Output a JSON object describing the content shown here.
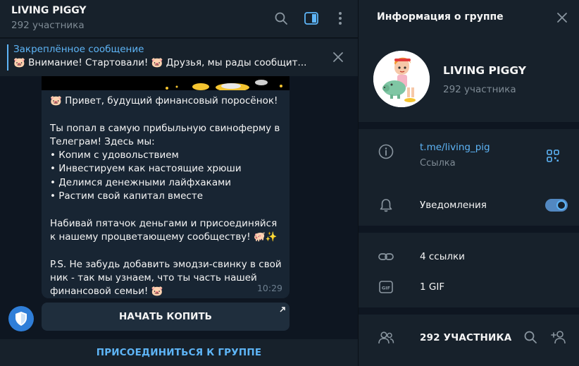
{
  "chat": {
    "title": "LIVING PIGGY",
    "subtitle": "292 участника",
    "pinned": {
      "title": "Закреплённое сообщение",
      "text": "🐷 Внимание! Стартовали! 🐷  Друзья, мы рады сообщит..."
    },
    "message": {
      "text": "🐷 Привет, будущий финансовый поросёнок!\n\nТы попал в самую прибыльную свиноферму в Телеграм! Здесь мы:\n• Копим с удовольствием\n• Инвестируем как настоящие хрюши\n• Делимся денежными лайфхаками\n• Растим свой капитал вместе\n\nНабивай пятачок деньгами и присоединяйся к нашему процветающему сообществу! 🐖✨\n\nP.S. Не забудь добавить эмодзи-свинку в свой ник - так мы узнаем, что ты часть нашей финансовой семьи! 🐷",
      "time": "10:29"
    },
    "inline_button": "НАЧАТЬ КОПИТЬ",
    "join_button": "ПРИСОЕДИНИТЬСЯ К ГРУППЕ"
  },
  "info": {
    "header_title": "Информация о группе",
    "group_name": "LIVING PIGGY",
    "group_members": "292 участника",
    "link": {
      "value": "t.me/living_pig",
      "label": "Ссылка"
    },
    "notifications": {
      "label": "Уведомления",
      "enabled": true
    },
    "media": {
      "links": "4 ссылки",
      "gifs": "1 GIF"
    },
    "members_title": "292 УЧАСТНИКА"
  },
  "colors": {
    "accent": "#5eb5f7",
    "panel": "#17212b",
    "background": "#0e1621",
    "bubble": "#182533"
  },
  "icons": [
    "search-icon",
    "sidebar-toggle-icon",
    "more-vertical-icon",
    "close-icon",
    "info-icon",
    "qr-code-icon",
    "bell-icon",
    "link-icon",
    "gif-icon",
    "members-icon",
    "add-member-icon",
    "external-arrow-icon",
    "shield-icon"
  ]
}
